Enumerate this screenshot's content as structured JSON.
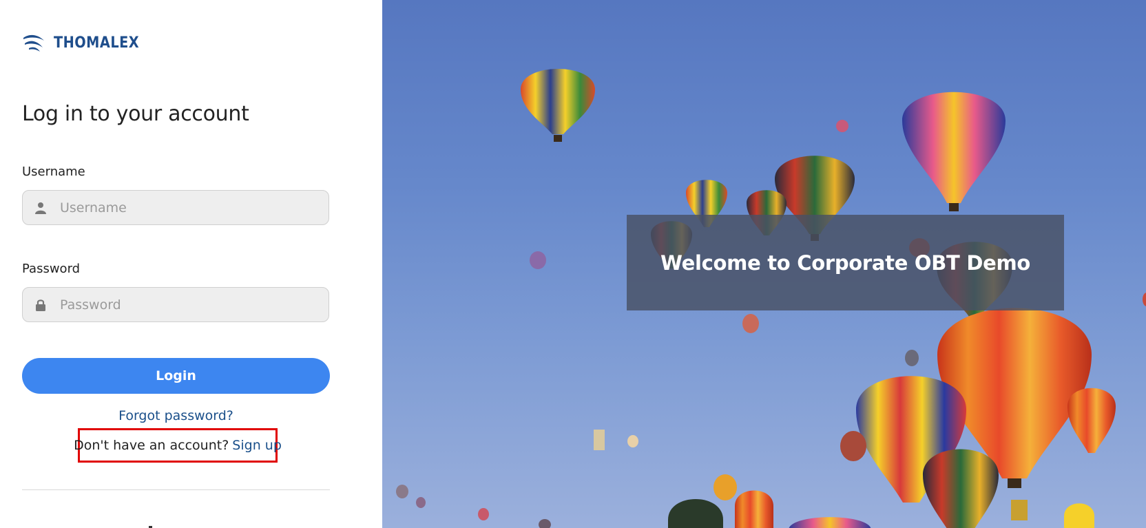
{
  "brand": {
    "name": "THOMALEX",
    "color": "#1f4e8c"
  },
  "login_form": {
    "heading": "Log in to your account",
    "username_label": "Username",
    "username_placeholder": "Username",
    "username_icon": "user-icon",
    "password_label": "Password",
    "password_placeholder": "Password",
    "password_icon": "lock-icon",
    "login_label": "Login",
    "forgot_password": "Forgot password?",
    "signup_prompt": "Don't have an account?",
    "signup_link": "Sign up",
    "accent_color": "#3d86f0",
    "link_color": "#1a4f8a",
    "highlight_color": "#e00000"
  },
  "hero": {
    "welcome_text": "Welcome to Corporate OBT Demo"
  }
}
